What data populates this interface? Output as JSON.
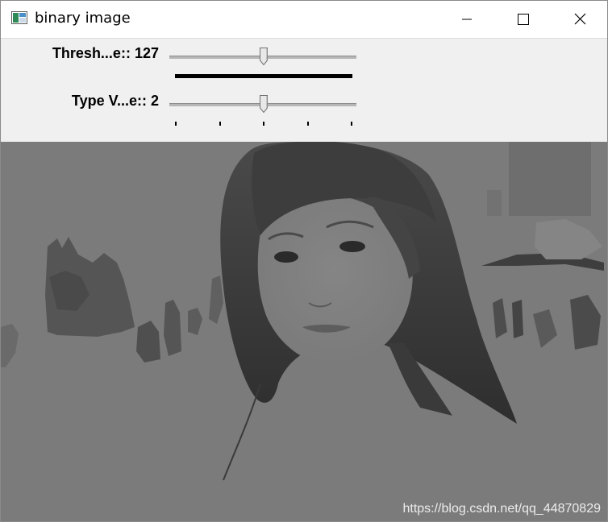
{
  "window": {
    "title": "binary image",
    "buttons": {
      "minimize": "minimize-icon",
      "maximize": "maximize-icon",
      "close": "close-icon"
    }
  },
  "trackbars": [
    {
      "name": "Thresh...e::",
      "value": "127",
      "position_fraction": 0.5
    },
    {
      "name": "Type V...e::",
      "value": "2",
      "position_fraction": 0.5
    }
  ],
  "image": {
    "description": "grayscale thresholded photo",
    "watermark": "https://blog.csdn.net/qq_44870829"
  },
  "colors": {
    "background_gray": "#7a7a7a",
    "panel": "#f0f0f0"
  }
}
